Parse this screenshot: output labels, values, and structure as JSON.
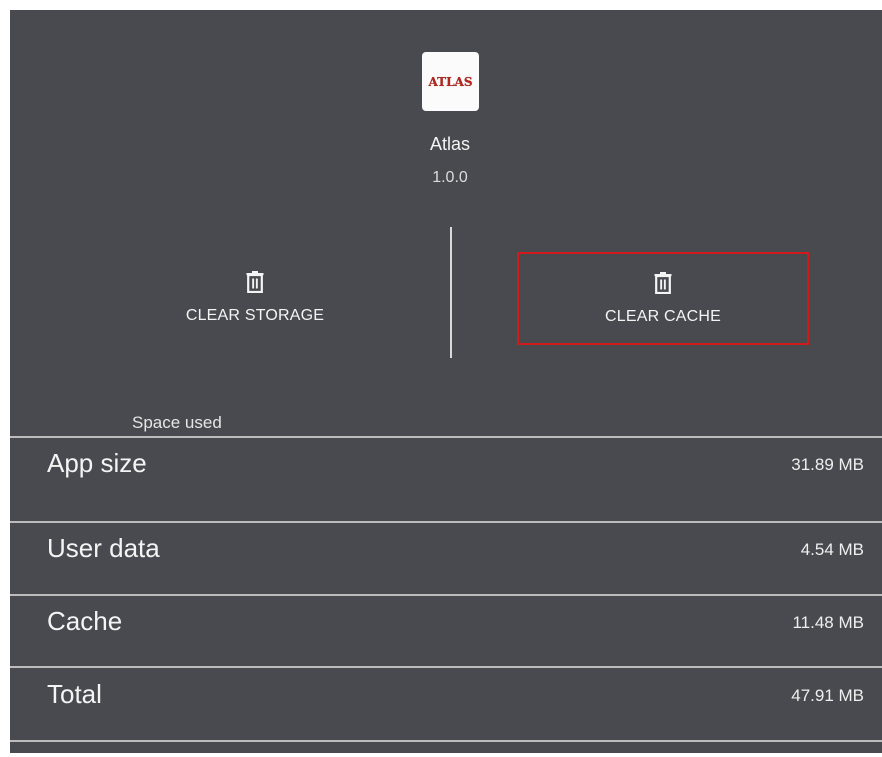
{
  "app": {
    "icon_text": "ATLAS",
    "name": "Atlas",
    "version": "1.0.0"
  },
  "actions": {
    "clear_storage": {
      "label": "CLEAR STORAGE",
      "icon": "trash-icon"
    },
    "clear_cache": {
      "label": "CLEAR CACHE",
      "icon": "trash-icon"
    }
  },
  "storage": {
    "section_label": "Space used",
    "rows": [
      {
        "label": "App size",
        "value": "31.89 MB"
      },
      {
        "label": "User data",
        "value": "4.54 MB"
      },
      {
        "label": "Cache",
        "value": "11.48 MB"
      },
      {
        "label": "Total",
        "value": "47.91 MB"
      }
    ]
  },
  "colors": {
    "panel_background": "#494a4f",
    "highlight_outline": "#d11a1a",
    "icon_text": "#b3261e",
    "text": "#f4f4f4"
  }
}
